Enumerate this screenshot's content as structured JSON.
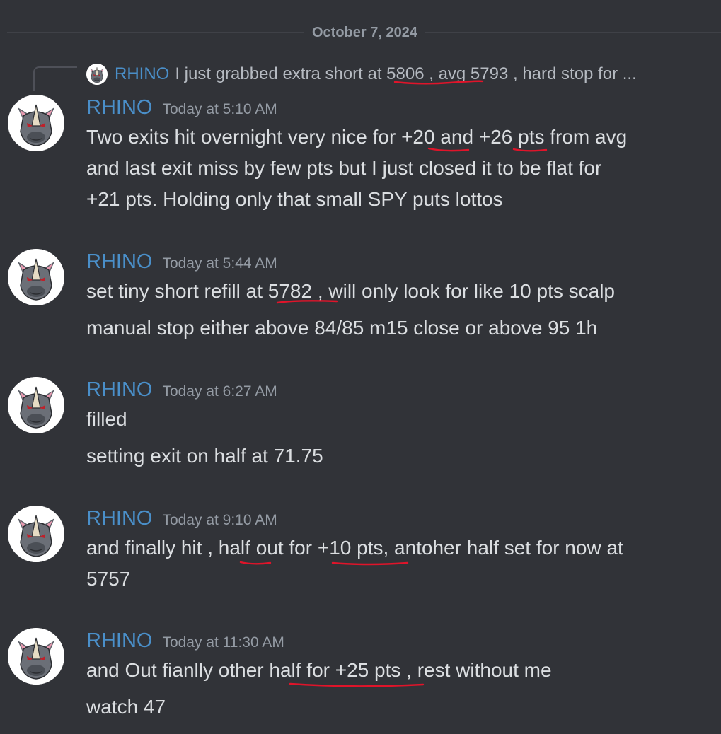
{
  "date_divider": "October 7, 2024",
  "reply": {
    "author": "RHINO",
    "text": "I just grabbed extra short at 5806 , avg 5793 , hard stop for ..."
  },
  "messages": [
    {
      "author": "RHINO",
      "time": "Today at 5:10 AM",
      "lines": [
        "Two exits hit overnight very nice for +20 and +26 pts from avg",
        "and last exit miss by few pts but I just closed it to be flat for",
        "+21 pts. Holding only that small SPY puts lottos"
      ]
    },
    {
      "author": "RHINO",
      "time": "Today at 5:44 AM",
      "lines": [
        "set tiny short refill at 5782 , will only look for like 10 pts scalp",
        "manual stop either above 84/85 m15 close or above 95 1h"
      ]
    },
    {
      "author": "RHINO",
      "time": "Today at 6:27 AM",
      "lines": [
        "filled",
        "setting exit on half at 71.75"
      ]
    },
    {
      "author": "RHINO",
      "time": "Today at 9:10 AM",
      "lines": [
        "and finally hit , half out for +10 pts, antoher half set for now at",
        "5757"
      ]
    },
    {
      "author": "RHINO",
      "time": "Today at 11:30 AM",
      "lines": [
        "and Out fianlly other half for +25 pts , rest without me",
        "watch 47"
      ]
    }
  ],
  "colors": {
    "background": "#313338",
    "author": "#4a8fc9",
    "text": "#dbdee1",
    "muted": "#949ba4",
    "annotation": "#e0142a"
  },
  "icons": {
    "avatar": "rhino-avatar-icon"
  }
}
